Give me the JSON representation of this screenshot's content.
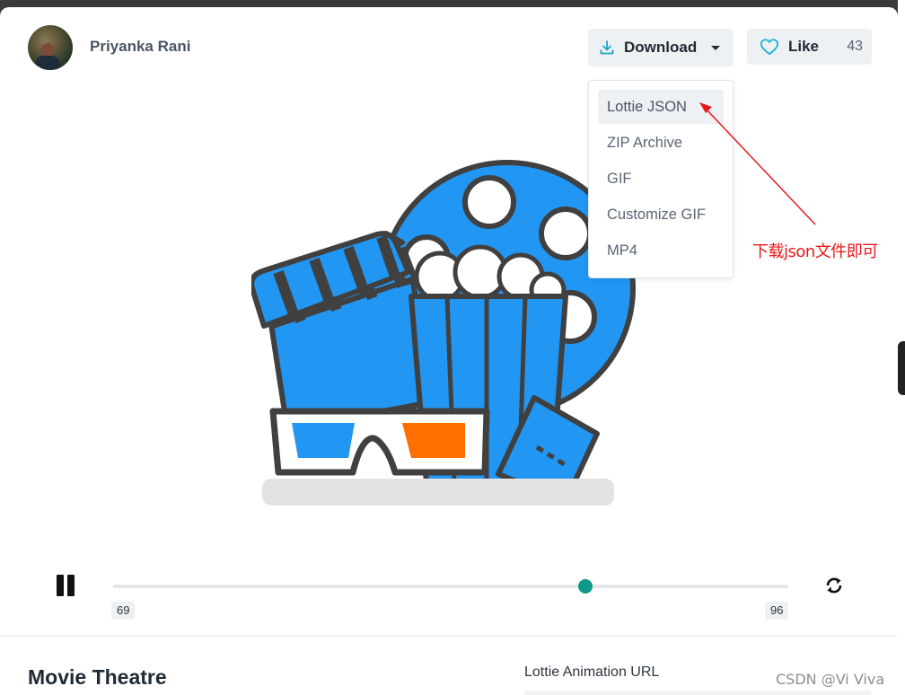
{
  "author": {
    "name": "Priyanka Rani"
  },
  "toolbar": {
    "download_label": "Download",
    "like_label": "Like",
    "like_count": "43"
  },
  "download_menu": {
    "items": [
      "Lottie JSON",
      "ZIP Archive",
      "GIF",
      "Customize GIF",
      "MP4"
    ],
    "active_index": 0
  },
  "annotation": {
    "text": "下载json文件即可",
    "color": "#e8181a"
  },
  "player": {
    "start_frame": "69",
    "end_frame": "96",
    "progress": 0.7,
    "state": "playing"
  },
  "animation": {
    "title": "Movie Theatre",
    "url_label": "Lottie Animation URL"
  },
  "watermark": "CSDN @Vi Viva",
  "icons": [
    "download-icon",
    "caret-down-icon",
    "heart-icon",
    "pause-icon",
    "loop-icon"
  ],
  "colors": {
    "accent": "#0c9986",
    "illustration_blue": "#2196f3",
    "illustration_orange": "#ff6f00",
    "button_bg": "#eef1f4"
  }
}
